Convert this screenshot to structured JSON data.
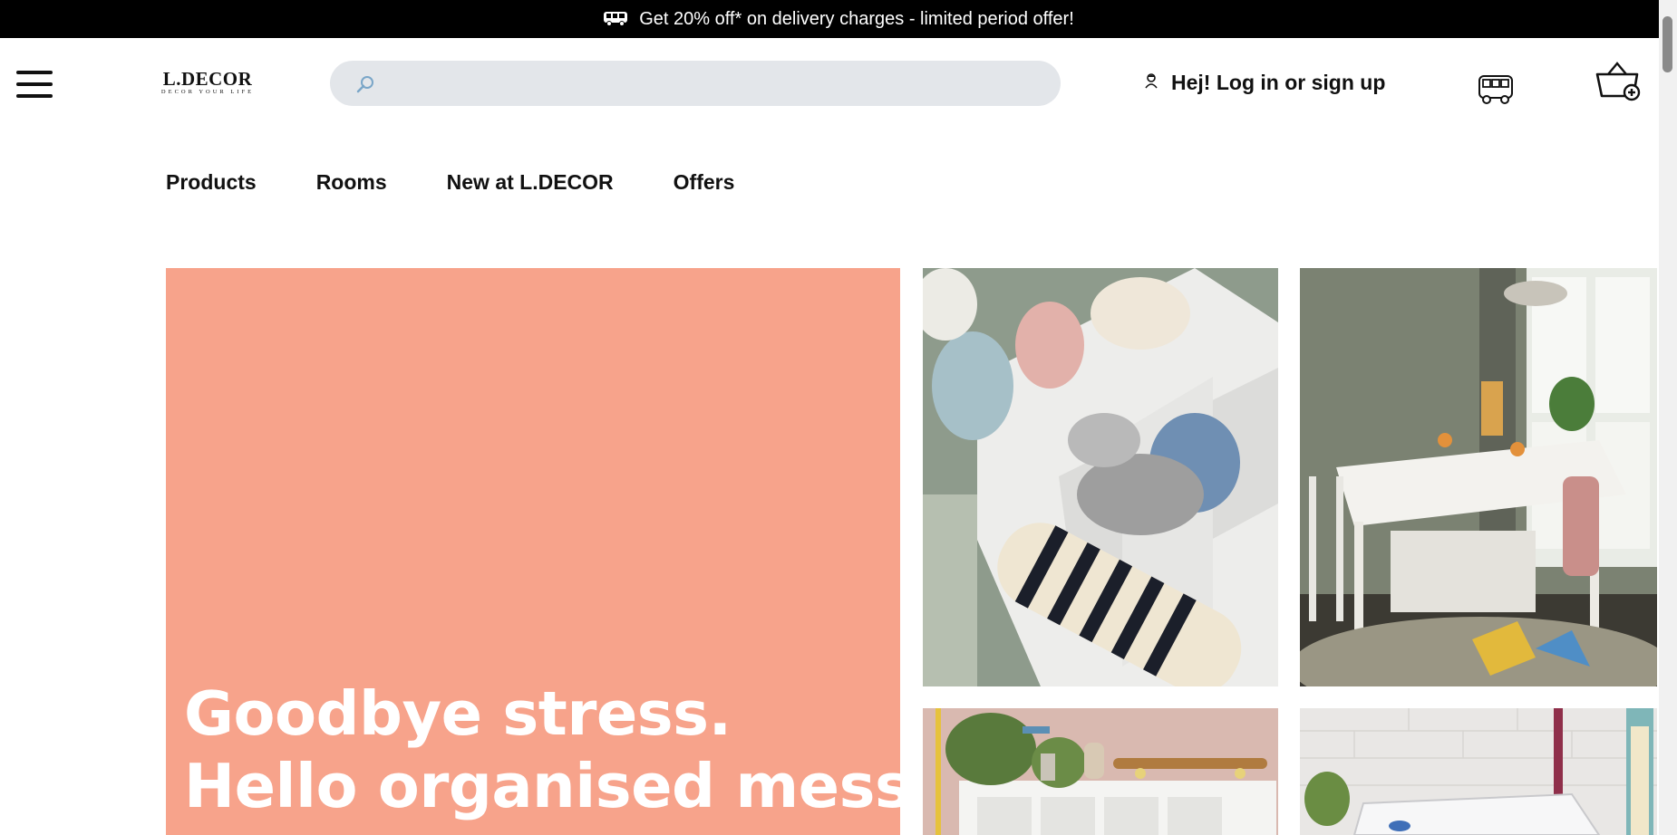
{
  "promo": {
    "text": "Get 20% off* on delivery charges - limited period offer!",
    "icon": "delivery-van-icon"
  },
  "header": {
    "logo": {
      "brand": "L.DECOR",
      "tagline": "DECOR YOUR LIFE"
    },
    "search": {
      "placeholder": "",
      "value": ""
    },
    "login_label": "Hej! Log in or sign up",
    "icons": [
      "menu-icon",
      "search-icon",
      "user-icon",
      "delivery-truck-icon",
      "basket-add-icon"
    ]
  },
  "nav": {
    "items": [
      {
        "label": "Products"
      },
      {
        "label": "Rooms"
      },
      {
        "label": "New at L.DECOR"
      },
      {
        "label": "Offers"
      }
    ]
  },
  "hero": {
    "headline_line1": "Goodbye stress.",
    "headline_line2": "Hello organised mess!",
    "background_color": "#f7a38b"
  },
  "tiles": [
    {
      "name": "socks-drawer-organiser"
    },
    {
      "name": "dining-room-table"
    },
    {
      "name": "shelf-with-skateboard"
    },
    {
      "name": "storage-bin"
    }
  ]
}
